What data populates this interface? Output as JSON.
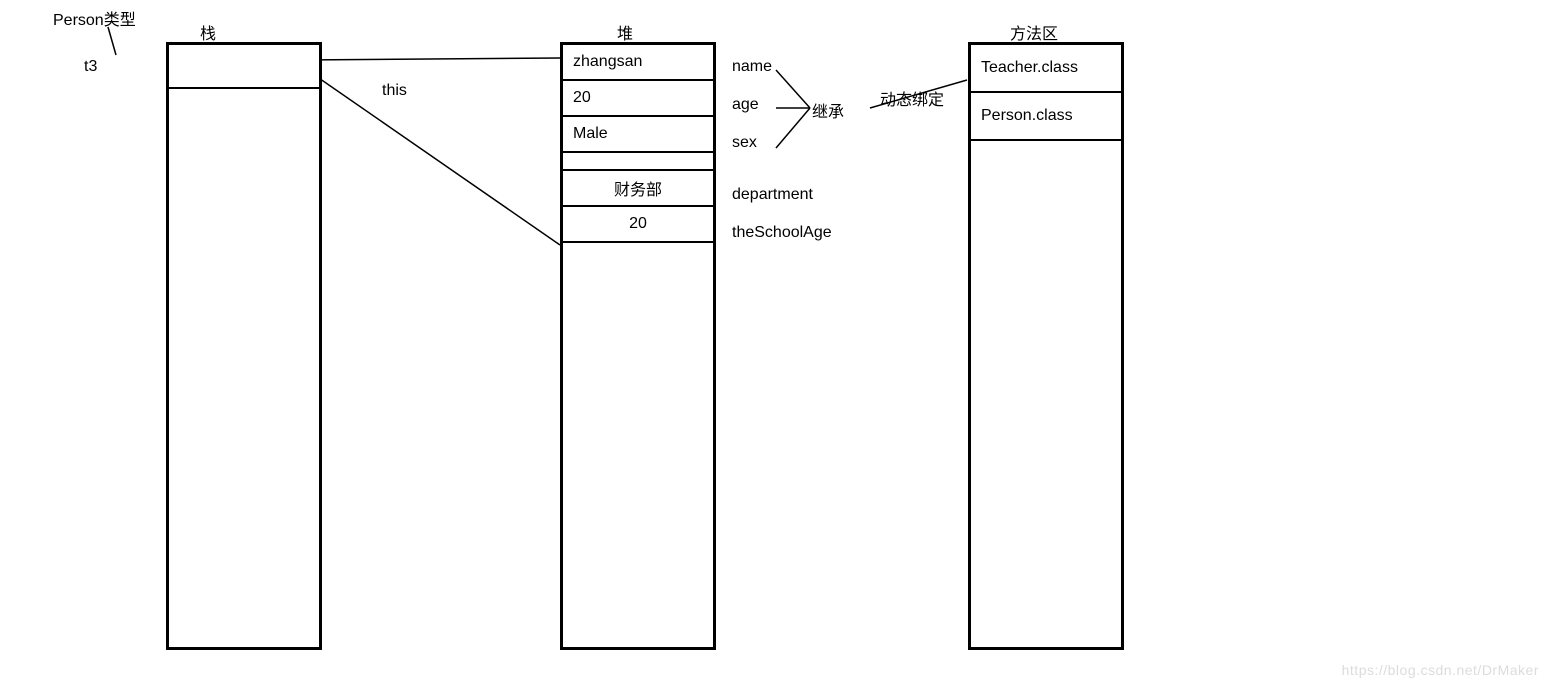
{
  "annotations": {
    "person_type": "Person类型",
    "t3": "t3",
    "this": "this",
    "inherit": "继承",
    "dynamic_binding": "动态绑定"
  },
  "stack": {
    "title": "栈"
  },
  "heap": {
    "title": "堆",
    "fields": [
      {
        "value": "zhangsan",
        "label": "name"
      },
      {
        "value": "20",
        "label": "age"
      },
      {
        "value": "Male",
        "label": "sex"
      },
      {
        "value": "财务部",
        "label": "department"
      },
      {
        "value": "20",
        "label": "theSchoolAge"
      }
    ]
  },
  "method_area": {
    "title": "方法区",
    "classes": [
      "Teacher.class",
      "Person.class"
    ]
  },
  "watermark": "https://blog.csdn.net/DrMaker"
}
